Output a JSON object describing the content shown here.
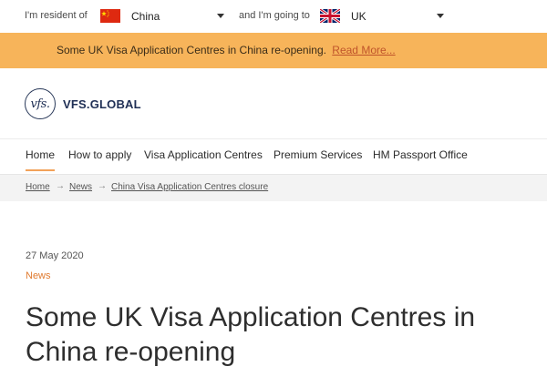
{
  "country_bar": {
    "resident_label": "I'm resident of",
    "resident_value": "China",
    "resident_flag": "china-flag-icon",
    "going_label": "and I'm going to",
    "going_value": "UK",
    "going_flag": "uk-flag-icon"
  },
  "alert": {
    "text": "Some UK Visa Application Centres in China re-opening.",
    "link": "Read More...",
    "bg_color": "#f7b45a"
  },
  "logo": {
    "mark": "vfs.",
    "text": "VFS.GLOBAL"
  },
  "nav": {
    "items": [
      "Home",
      "How to apply",
      "Visa Application Centres",
      "Premium Services",
      "HM Passport Office"
    ],
    "active_index": 0,
    "accent_color": "#f2a25a"
  },
  "breadcrumb": {
    "items": [
      "Home",
      "News",
      "China Visa Application Centres closure"
    ],
    "separator": "→"
  },
  "article": {
    "date": "27 May 2020",
    "category": "News",
    "title": "Some UK Visa Application Centres in China re-opening",
    "category_color": "#e07a2e"
  }
}
